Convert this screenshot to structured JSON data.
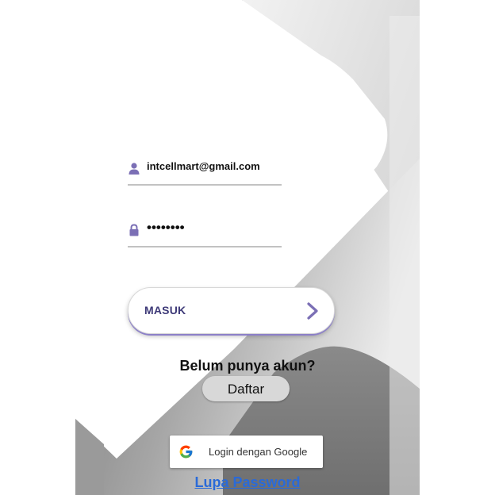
{
  "login": {
    "email_value": "intcellmart@gmail.com",
    "password_value": "••••••••",
    "submit_label": "MASUK",
    "no_account_text": "Belum punya akun?",
    "register_label": "Daftar",
    "google_label": "Login dengan Google",
    "forgot_label": "Lupa Password"
  },
  "icons": {
    "email": "user-icon",
    "password": "lock-icon",
    "submit": "chevron-right-icon",
    "google": "google-logo-icon"
  },
  "colors": {
    "accent": "#7b6fb5",
    "submit_text": "#3e3a78",
    "link": "#2a6ad8"
  }
}
